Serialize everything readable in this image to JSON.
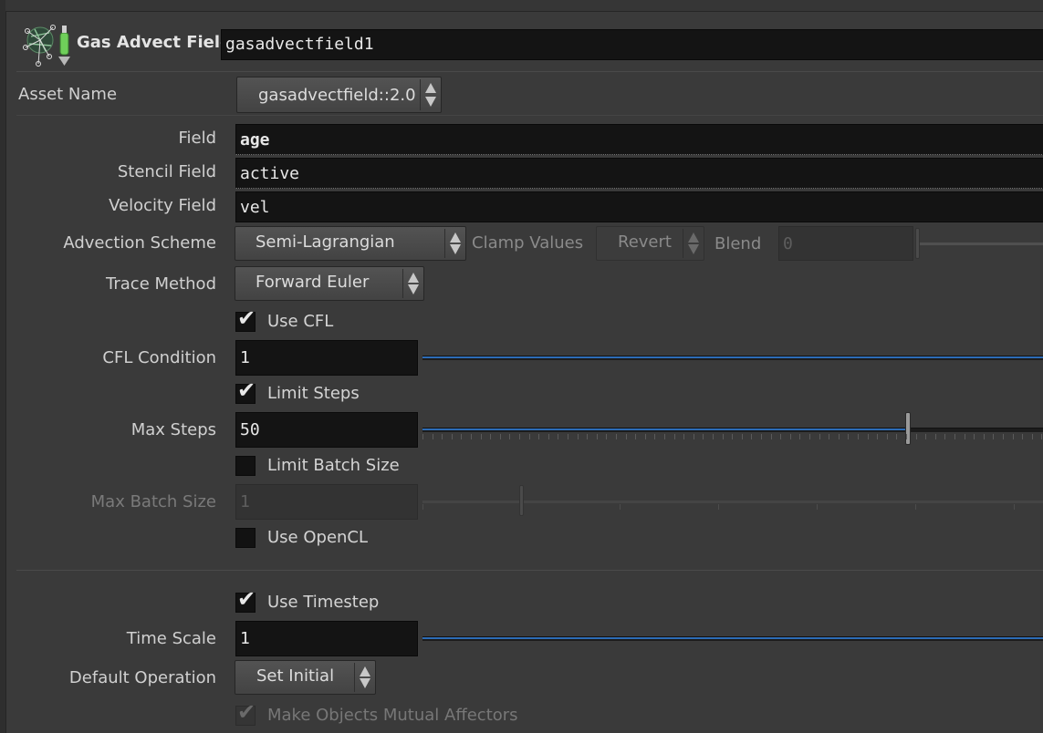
{
  "header": {
    "node_type": "Gas Advect Field",
    "node_name": "gasadvectfield1"
  },
  "asset": {
    "label": "Asset Name",
    "value": "gasadvectfield::2.0"
  },
  "params": {
    "field": {
      "label": "Field",
      "value": "age"
    },
    "stencil_field": {
      "label": "Stencil Field",
      "value": "active"
    },
    "velocity_field": {
      "label": "Velocity Field",
      "value": "vel"
    },
    "advection_scheme": {
      "label": "Advection Scheme",
      "value": "Semi-Lagrangian"
    },
    "clamp_values": {
      "label": "Clamp Values",
      "value": "Revert"
    },
    "blend": {
      "label": "Blend",
      "value": "0"
    },
    "trace_method": {
      "label": "Trace Method",
      "value": "Forward Euler"
    },
    "use_cfl": {
      "label": "Use CFL",
      "checked": true
    },
    "cfl_condition": {
      "label": "CFL Condition",
      "value": "1"
    },
    "limit_steps": {
      "label": "Limit Steps",
      "checked": true
    },
    "max_steps": {
      "label": "Max Steps",
      "value": "50"
    },
    "limit_batch_size": {
      "label": "Limit Batch Size",
      "checked": false
    },
    "max_batch_size": {
      "label": "Max Batch Size",
      "value": "1"
    },
    "use_opencl": {
      "label": "Use OpenCL",
      "checked": false
    },
    "use_timestep": {
      "label": "Use Timestep",
      "checked": true
    },
    "time_scale": {
      "label": "Time Scale",
      "value": "1"
    },
    "default_operation": {
      "label": "Default Operation",
      "value": "Set Initial"
    },
    "make_mutual_affectors": {
      "label": "Make Objects Mutual Affectors",
      "checked": true
    }
  },
  "colors": {
    "background": "#3a3a3a",
    "field_bg": "#141414",
    "slider_fill": "#2d6cb6"
  }
}
